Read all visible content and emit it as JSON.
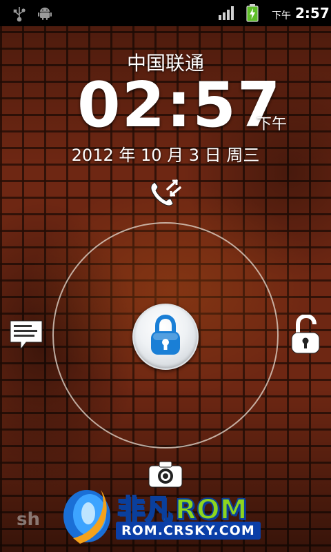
{
  "status_bar": {
    "icons": [
      "usb-icon",
      "android-debug-icon",
      "signal-icon",
      "battery-charging-icon"
    ],
    "ampm": "下午",
    "time": "2:57"
  },
  "lock_screen": {
    "carrier": "中国联通",
    "clock": "02:57",
    "clock_ampm": "下午",
    "date": "2012 年 10 月 3 日 周三",
    "targets": {
      "top": "phone-icon",
      "left": "message-icon",
      "right": "unlock-icon",
      "bottom": "camera-icon"
    },
    "handle_icon": "lock-icon"
  },
  "watermark": {
    "left_text": "sh",
    "brand_cn": "非凡",
    "brand_rom": "ROM",
    "url": "ROM.CRSKY.COM"
  },
  "colors": {
    "accent_blue": "#1a7fd6",
    "brand_green": "#8ed61f",
    "brand_blue": "#0b3fa8",
    "battery_green": "#5fbf2a"
  }
}
